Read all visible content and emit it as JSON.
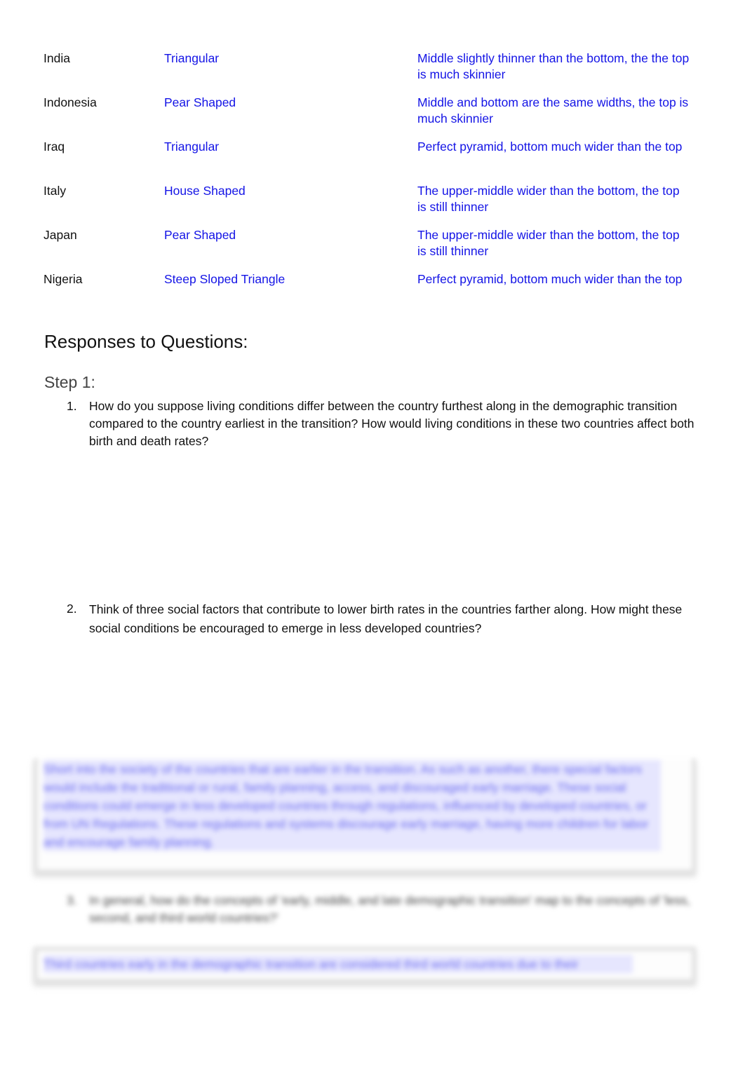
{
  "pyramid_table": {
    "rows": [
      {
        "country": "India",
        "shape": "Triangular",
        "description": "Middle slightly thinner than the bottom, the the top is much skinnier"
      },
      {
        "country": "Indonesia",
        "shape": "Pear Shaped",
        "description": "Middle and bottom are the same widths, the top is much skinnier"
      },
      {
        "country": "Iraq",
        "shape": "Triangular",
        "description": "Perfect pyramid, bottom much wider than the top"
      },
      {
        "country": "Italy",
        "shape": "House Shaped",
        "description": "The upper-middle wider than the bottom, the top is still thinner"
      },
      {
        "country": "Japan",
        "shape": "Pear Shaped",
        "description": "The upper-middle wider than the bottom, the top is still thinner"
      },
      {
        "country": "Nigeria",
        "shape": "Steep Sloped Triangle",
        "description": "Perfect pyramid, bottom much wider than the top"
      }
    ]
  },
  "responses_heading": "Responses to Questions:",
  "step_heading": "Step 1:",
  "questions": [
    {
      "number": "1.",
      "text": "How do you suppose living conditions differ between the country furthest along in the demographic transition compared to the country earliest in the transition? How would living conditions in these two countries affect both birth and death rates?"
    },
    {
      "number": "2.",
      "text": "Think of three social factors that contribute to lower birth rates in the countries farther along. How might these social conditions be encouraged to emerge in less developed countries?"
    }
  ],
  "blurred_preview": {
    "answer_1": "Short into the society of the countries that are earlier in the transition. As such as another, there special factors would include the traditional or rural, family planning, access, and discouraged early marriage. These social conditions could emerge in less developed countries through regulations, influenced by developed countries, or from UN Regulations. These regulations and systems discourage early marriage, having more children for labor and encourage family planning.",
    "question_3_number": "3.",
    "question_3": "In general, how do the concepts of 'early, middle, and late demographic transition' map to the concepts of 'less, second, and third world countries?'",
    "answer_2": "Third countries early in the demographic transition are considered third world countries due to their"
  }
}
